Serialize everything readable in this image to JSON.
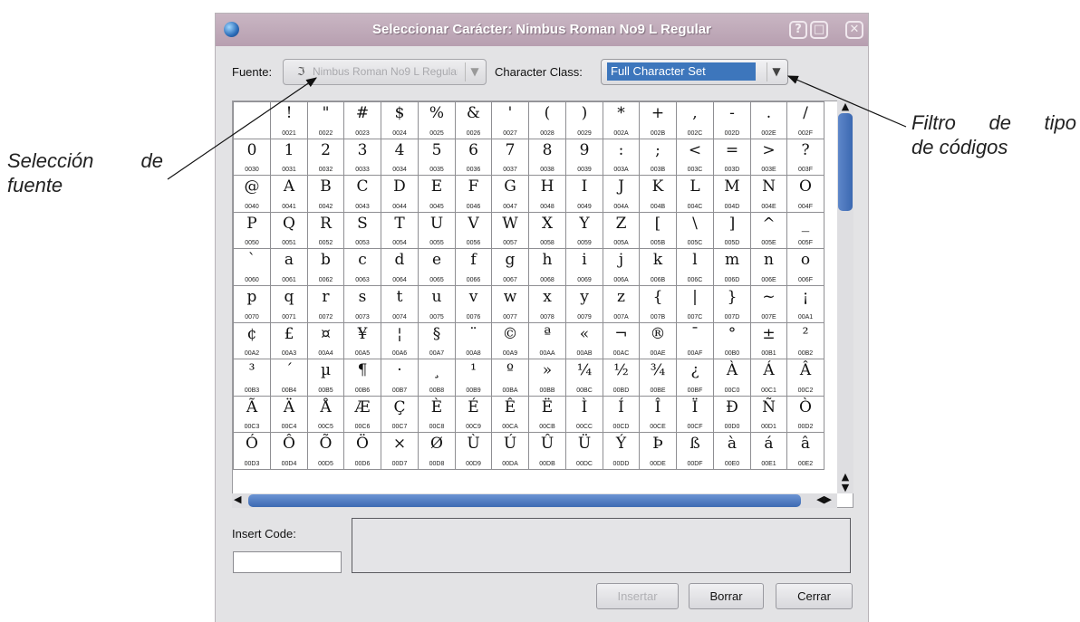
{
  "window": {
    "title": "Seleccionar Carácter: Nimbus Roman No9 L Regular",
    "buttons": {
      "help": "?",
      "maximize": "□",
      "close": "✕"
    }
  },
  "annotations": {
    "font_selection_line1_a": "Selección",
    "font_selection_line1_b": "de",
    "font_selection_line2": "fuente",
    "filter_line1_a": "Filtro",
    "filter_line1_b": "de",
    "filter_line1_c": "tipo",
    "filter_line2": "de códigos"
  },
  "font_selector": {
    "label": "Fuente:",
    "icon_glyph": "ℑ",
    "value": "Nimbus Roman No9 L Regular",
    "arrow": "▼"
  },
  "class_selector": {
    "label": "Character Class:",
    "value": "Full Character Set",
    "arrow": "▼"
  },
  "characters": [
    {
      "ch": " ",
      "code": ""
    },
    {
      "ch": "!",
      "code": "0021"
    },
    {
      "ch": "\"",
      "code": "0022"
    },
    {
      "ch": "#",
      "code": "0023"
    },
    {
      "ch": "$",
      "code": "0024"
    },
    {
      "ch": "%",
      "code": "0025"
    },
    {
      "ch": "&",
      "code": "0026"
    },
    {
      "ch": "'",
      "code": "0027"
    },
    {
      "ch": "(",
      "code": "0028"
    },
    {
      "ch": ")",
      "code": "0029"
    },
    {
      "ch": "*",
      "code": "002A"
    },
    {
      "ch": "+",
      "code": "002B"
    },
    {
      "ch": ",",
      "code": "002C"
    },
    {
      "ch": "-",
      "code": "002D"
    },
    {
      "ch": ".",
      "code": "002E"
    },
    {
      "ch": "/",
      "code": "002F"
    },
    {
      "ch": "0",
      "code": "0030"
    },
    {
      "ch": "1",
      "code": "0031"
    },
    {
      "ch": "2",
      "code": "0032"
    },
    {
      "ch": "3",
      "code": "0033"
    },
    {
      "ch": "4",
      "code": "0034"
    },
    {
      "ch": "5",
      "code": "0035"
    },
    {
      "ch": "6",
      "code": "0036"
    },
    {
      "ch": "7",
      "code": "0037"
    },
    {
      "ch": "8",
      "code": "0038"
    },
    {
      "ch": "9",
      "code": "0039"
    },
    {
      "ch": ":",
      "code": "003A"
    },
    {
      "ch": ";",
      "code": "003B"
    },
    {
      "ch": "<",
      "code": "003C"
    },
    {
      "ch": "=",
      "code": "003D"
    },
    {
      "ch": ">",
      "code": "003E"
    },
    {
      "ch": "?",
      "code": "003F"
    },
    {
      "ch": "@",
      "code": "0040"
    },
    {
      "ch": "A",
      "code": "0041"
    },
    {
      "ch": "B",
      "code": "0042"
    },
    {
      "ch": "C",
      "code": "0043"
    },
    {
      "ch": "D",
      "code": "0044"
    },
    {
      "ch": "E",
      "code": "0045"
    },
    {
      "ch": "F",
      "code": "0046"
    },
    {
      "ch": "G",
      "code": "0047"
    },
    {
      "ch": "H",
      "code": "0048"
    },
    {
      "ch": "I",
      "code": "0049"
    },
    {
      "ch": "J",
      "code": "004A"
    },
    {
      "ch": "K",
      "code": "004B"
    },
    {
      "ch": "L",
      "code": "004C"
    },
    {
      "ch": "M",
      "code": "004D"
    },
    {
      "ch": "N",
      "code": "004E"
    },
    {
      "ch": "O",
      "code": "004F"
    },
    {
      "ch": "P",
      "code": "0050"
    },
    {
      "ch": "Q",
      "code": "0051"
    },
    {
      "ch": "R",
      "code": "0052"
    },
    {
      "ch": "S",
      "code": "0053"
    },
    {
      "ch": "T",
      "code": "0054"
    },
    {
      "ch": "U",
      "code": "0055"
    },
    {
      "ch": "V",
      "code": "0056"
    },
    {
      "ch": "W",
      "code": "0057"
    },
    {
      "ch": "X",
      "code": "0058"
    },
    {
      "ch": "Y",
      "code": "0059"
    },
    {
      "ch": "Z",
      "code": "005A"
    },
    {
      "ch": "[",
      "code": "005B"
    },
    {
      "ch": "\\",
      "code": "005C"
    },
    {
      "ch": "]",
      "code": "005D"
    },
    {
      "ch": "^",
      "code": "005E"
    },
    {
      "ch": "_",
      "code": "005F"
    },
    {
      "ch": "`",
      "code": "0060"
    },
    {
      "ch": "a",
      "code": "0061"
    },
    {
      "ch": "b",
      "code": "0062"
    },
    {
      "ch": "c",
      "code": "0063"
    },
    {
      "ch": "d",
      "code": "0064"
    },
    {
      "ch": "e",
      "code": "0065"
    },
    {
      "ch": "f",
      "code": "0066"
    },
    {
      "ch": "g",
      "code": "0067"
    },
    {
      "ch": "h",
      "code": "0068"
    },
    {
      "ch": "i",
      "code": "0069"
    },
    {
      "ch": "j",
      "code": "006A"
    },
    {
      "ch": "k",
      "code": "006B"
    },
    {
      "ch": "l",
      "code": "006C"
    },
    {
      "ch": "m",
      "code": "006D"
    },
    {
      "ch": "n",
      "code": "006E"
    },
    {
      "ch": "o",
      "code": "006F"
    },
    {
      "ch": "p",
      "code": "0070"
    },
    {
      "ch": "q",
      "code": "0071"
    },
    {
      "ch": "r",
      "code": "0072"
    },
    {
      "ch": "s",
      "code": "0073"
    },
    {
      "ch": "t",
      "code": "0074"
    },
    {
      "ch": "u",
      "code": "0075"
    },
    {
      "ch": "v",
      "code": "0076"
    },
    {
      "ch": "w",
      "code": "0077"
    },
    {
      "ch": "x",
      "code": "0078"
    },
    {
      "ch": "y",
      "code": "0079"
    },
    {
      "ch": "z",
      "code": "007A"
    },
    {
      "ch": "{",
      "code": "007B"
    },
    {
      "ch": "|",
      "code": "007C"
    },
    {
      "ch": "}",
      "code": "007D"
    },
    {
      "ch": "~",
      "code": "007E"
    },
    {
      "ch": "¡",
      "code": "00A1"
    },
    {
      "ch": "¢",
      "code": "00A2"
    },
    {
      "ch": "£",
      "code": "00A3"
    },
    {
      "ch": "¤",
      "code": "00A4"
    },
    {
      "ch": "¥",
      "code": "00A5"
    },
    {
      "ch": "¦",
      "code": "00A6"
    },
    {
      "ch": "§",
      "code": "00A7"
    },
    {
      "ch": "¨",
      "code": "00A8"
    },
    {
      "ch": "©",
      "code": "00A9"
    },
    {
      "ch": "ª",
      "code": "00AA"
    },
    {
      "ch": "«",
      "code": "00AB"
    },
    {
      "ch": "¬",
      "code": "00AC"
    },
    {
      "ch": "®",
      "code": "00AE"
    },
    {
      "ch": "¯",
      "code": "00AF"
    },
    {
      "ch": "°",
      "code": "00B0"
    },
    {
      "ch": "±",
      "code": "00B1"
    },
    {
      "ch": "²",
      "code": "00B2"
    },
    {
      "ch": "³",
      "code": "00B3"
    },
    {
      "ch": "´",
      "code": "00B4"
    },
    {
      "ch": "µ",
      "code": "00B5"
    },
    {
      "ch": "¶",
      "code": "00B6"
    },
    {
      "ch": "·",
      "code": "00B7"
    },
    {
      "ch": "¸",
      "code": "00B8"
    },
    {
      "ch": "¹",
      "code": "00B9"
    },
    {
      "ch": "º",
      "code": "00BA"
    },
    {
      "ch": "»",
      "code": "00BB"
    },
    {
      "ch": "¼",
      "code": "00BC"
    },
    {
      "ch": "½",
      "code": "00BD"
    },
    {
      "ch": "¾",
      "code": "00BE"
    },
    {
      "ch": "¿",
      "code": "00BF"
    },
    {
      "ch": "À",
      "code": "00C0"
    },
    {
      "ch": "Á",
      "code": "00C1"
    },
    {
      "ch": "Â",
      "code": "00C2"
    },
    {
      "ch": "Ã",
      "code": "00C3"
    },
    {
      "ch": "Ä",
      "code": "00C4"
    },
    {
      "ch": "Å",
      "code": "00C5"
    },
    {
      "ch": "Æ",
      "code": "00C6"
    },
    {
      "ch": "Ç",
      "code": "00C7"
    },
    {
      "ch": "È",
      "code": "00C8"
    },
    {
      "ch": "É",
      "code": "00C9"
    },
    {
      "ch": "Ê",
      "code": "00CA"
    },
    {
      "ch": "Ë",
      "code": "00CB"
    },
    {
      "ch": "Ì",
      "code": "00CC"
    },
    {
      "ch": "Í",
      "code": "00CD"
    },
    {
      "ch": "Î",
      "code": "00CE"
    },
    {
      "ch": "Ï",
      "code": "00CF"
    },
    {
      "ch": "Ð",
      "code": "00D0"
    },
    {
      "ch": "Ñ",
      "code": "00D1"
    },
    {
      "ch": "Ò",
      "code": "00D2"
    },
    {
      "ch": "Ó",
      "code": "00D3"
    },
    {
      "ch": "Ô",
      "code": "00D4"
    },
    {
      "ch": "Õ",
      "code": "00D5"
    },
    {
      "ch": "Ö",
      "code": "00D6"
    },
    {
      "ch": "×",
      "code": "00D7"
    },
    {
      "ch": "Ø",
      "code": "00D8"
    },
    {
      "ch": "Ù",
      "code": "00D9"
    },
    {
      "ch": "Ú",
      "code": "00DA"
    },
    {
      "ch": "Û",
      "code": "00DB"
    },
    {
      "ch": "Ü",
      "code": "00DC"
    },
    {
      "ch": "Ý",
      "code": "00DD"
    },
    {
      "ch": "Þ",
      "code": "00DE"
    },
    {
      "ch": "ß",
      "code": "00DF"
    },
    {
      "ch": "à",
      "code": "00E0"
    },
    {
      "ch": "á",
      "code": "00E1"
    },
    {
      "ch": "â",
      "code": "00E2"
    }
  ],
  "insert_code": {
    "label": "Insert Code:",
    "value": ""
  },
  "actions": {
    "insert": "Insertar",
    "clear": "Borrar",
    "close": "Cerrar"
  },
  "scrollbars": {
    "up": "▲",
    "down": "▼",
    "left": "◀",
    "right": "▶",
    "lr": "◀▶"
  },
  "colors": {
    "titlebar": "#c2adbb",
    "selection": "#3d76bc",
    "scroll_thumb": "#4a77be",
    "window_bg": "#e3e3e5"
  }
}
